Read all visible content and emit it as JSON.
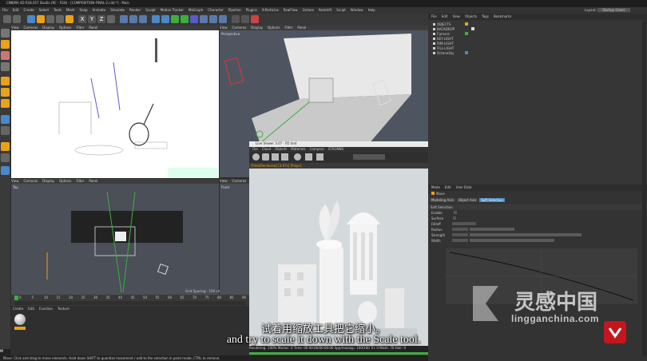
{
  "window": {
    "title": "CINEMA 4D R18.057 Studio (RC - R18) - [COMPOSITION-FINAL-2.c4d *] - Main",
    "layout_label": "Layout:",
    "layout_value": "Startup (User)"
  },
  "menubar": [
    "File",
    "Edit",
    "Create",
    "Select",
    "Tools",
    "Mesh",
    "Snap",
    "Animate",
    "Simulate",
    "Render",
    "Sculpt",
    "Motion Tracker",
    "MoGraph",
    "Character",
    "Pipeline",
    "Plugins",
    "X-Particles",
    "RealFlow",
    "Octane",
    "Redshift",
    "Script",
    "Window",
    "Help"
  ],
  "toolbar": {
    "axis_labels": [
      "X",
      "Y",
      "Z"
    ]
  },
  "viewports": {
    "top_left": {
      "menu": [
        "View",
        "Cameras",
        "Display",
        "Options",
        "Filter",
        "Panel"
      ]
    },
    "perspective": {
      "menu": [
        "View",
        "Cameras",
        "Display",
        "Options",
        "Filter",
        "Panel"
      ],
      "label": "Perspective"
    },
    "top": {
      "menu": [
        "View",
        "Cameras",
        "Display",
        "Options",
        "Filter",
        "Panel"
      ],
      "label": "Top",
      "grid_spacing": "Grid Spacing : 100 cm"
    },
    "front": {
      "menu": [
        "View",
        "Cameras"
      ],
      "label": "Front"
    }
  },
  "live_viewer": {
    "title": "Live Viewer 3.07 - R5 test",
    "menu": [
      "File",
      "Cloud",
      "Objects",
      "Materials",
      "Compare",
      "STRONNS"
    ],
    "stats": "[Total/Rendered] [3.07s] [Polys]",
    "status": "Rendering: 100%  Ms/sec: 0  Time: 00:00:06/00:00:06  Spp/maxspp: 100/100  Tri: 0  Mesh: 70  Hair: 0"
  },
  "object_manager": {
    "menu": [
      "File",
      "Edit",
      "View",
      "Objects",
      "Tags",
      "Bookmarks"
    ],
    "objects": [
      "OBJECTS",
      "BACKDROP",
      "Camera",
      "KEY-LIGHT",
      "RIM-LIGHT",
      "FILL-LIGHT",
      "OctaneSky"
    ]
  },
  "attribute_manager": {
    "menu": [
      "Mode",
      "Edit",
      "User Data"
    ],
    "object_name": "Move",
    "tabs": [
      "Modeling Axis",
      "Object Axis",
      "Soft Selection"
    ],
    "section": "Soft Selection",
    "fields": [
      "Enable",
      "Surface",
      "Falloff",
      "Radius",
      "Strength",
      "Width"
    ]
  },
  "timeline": {
    "ticks": [
      "0",
      "5",
      "10",
      "15",
      "20",
      "25",
      "30",
      "35",
      "40",
      "45",
      "50",
      "55",
      "60",
      "65",
      "70",
      "75",
      "80",
      "85",
      "90"
    ]
  },
  "material_manager": {
    "menu": [
      "Create",
      "Edit",
      "Function",
      "Texture"
    ]
  },
  "status_bar": "Move: Click and drag to move elements. Hold down SHIFT to quantize movement / add to the selection in point mode, CTRL to remove.",
  "subtitles": {
    "chinese": "试着用缩放工具把它缩小。",
    "english": "and try to scale it down with the Scale tool."
  },
  "watermark": {
    "chinese": "灵感中国",
    "url": "lingganchina.com"
  },
  "colors": {
    "accent_orange": "#e8a21c",
    "selection_blue": "#4a88c7",
    "watermark_red": "#c4161c",
    "timeline_green": "#3fae3f"
  }
}
